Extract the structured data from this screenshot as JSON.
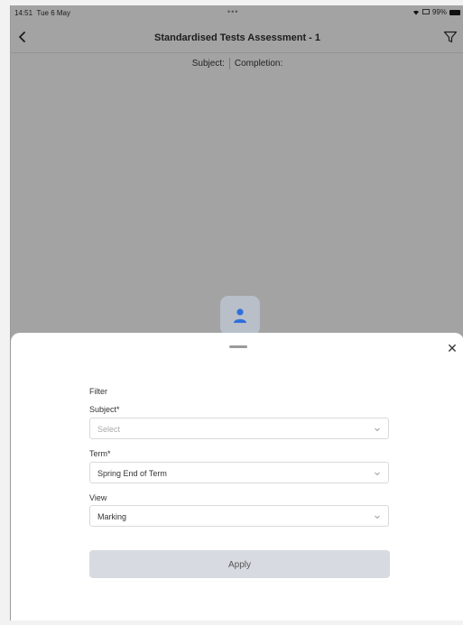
{
  "status_bar": {
    "time": "14:51",
    "date": "Tue 6 May",
    "battery": "99%"
  },
  "header": {
    "title": "Standardised Tests Assessment - 1",
    "back_icon": "chevron-left-icon",
    "filter_icon": "filter-funnel-icon"
  },
  "subheader": {
    "subject_label": "Subject:",
    "completion_label": "Completion:"
  },
  "sheet": {
    "heading": "Filter",
    "subject": {
      "label": "Subject*",
      "value": "",
      "placeholder": "Select"
    },
    "term": {
      "label": "Term*",
      "value": "Spring End of Term"
    },
    "view": {
      "label": "View",
      "value": "Marking"
    },
    "apply_label": "Apply",
    "close_icon": "close-icon"
  },
  "colors": {
    "overlay": "#a3a3a3",
    "sheet": "#ffffff",
    "apply_button": "#d7dbe1",
    "avatar_icon": "#2f6fdc"
  }
}
